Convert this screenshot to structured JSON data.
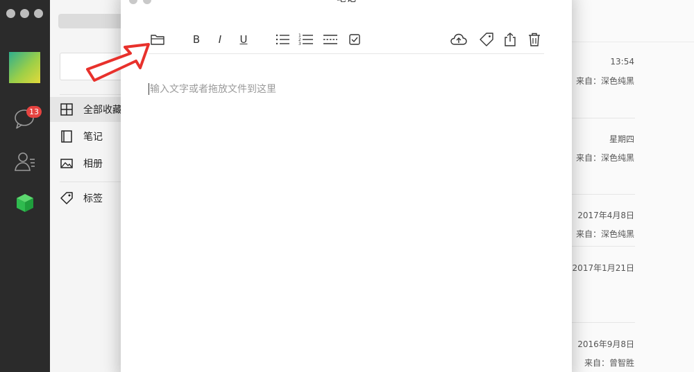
{
  "app": {
    "unread_badge": "13"
  },
  "favorites": {
    "items": [
      {
        "label": "全部收藏",
        "icon": "grid-icon",
        "active": true
      },
      {
        "label": "笔记",
        "icon": "notebook-icon",
        "active": false
      },
      {
        "label": "相册",
        "icon": "image-icon",
        "active": false
      },
      {
        "label": "标签",
        "icon": "tag-icon",
        "active": false
      }
    ]
  },
  "list": {
    "entries": [
      {
        "date": "13:54",
        "source": "来自：深色纯黑"
      },
      {
        "date": "星期四",
        "source": "来自：深色纯黑"
      },
      {
        "date": "2017年4月8日",
        "source": "来自：深色纯黑"
      },
      {
        "date": "2017年1月21日",
        "source": ""
      },
      {
        "date": "2016年9月8日",
        "source": "来自：曾智胜"
      }
    ]
  },
  "dialog": {
    "title": "笔记",
    "editor_placeholder": "输入文字或者拖放文件到这里",
    "toolbar": {
      "bold": "B",
      "italic": "I",
      "underline": "U"
    }
  },
  "colors": {
    "annotation_arrow": "#e8312c",
    "badge": "#e64340",
    "rail": "#2b2b2b",
    "active_cube": "#2fbb4f"
  }
}
